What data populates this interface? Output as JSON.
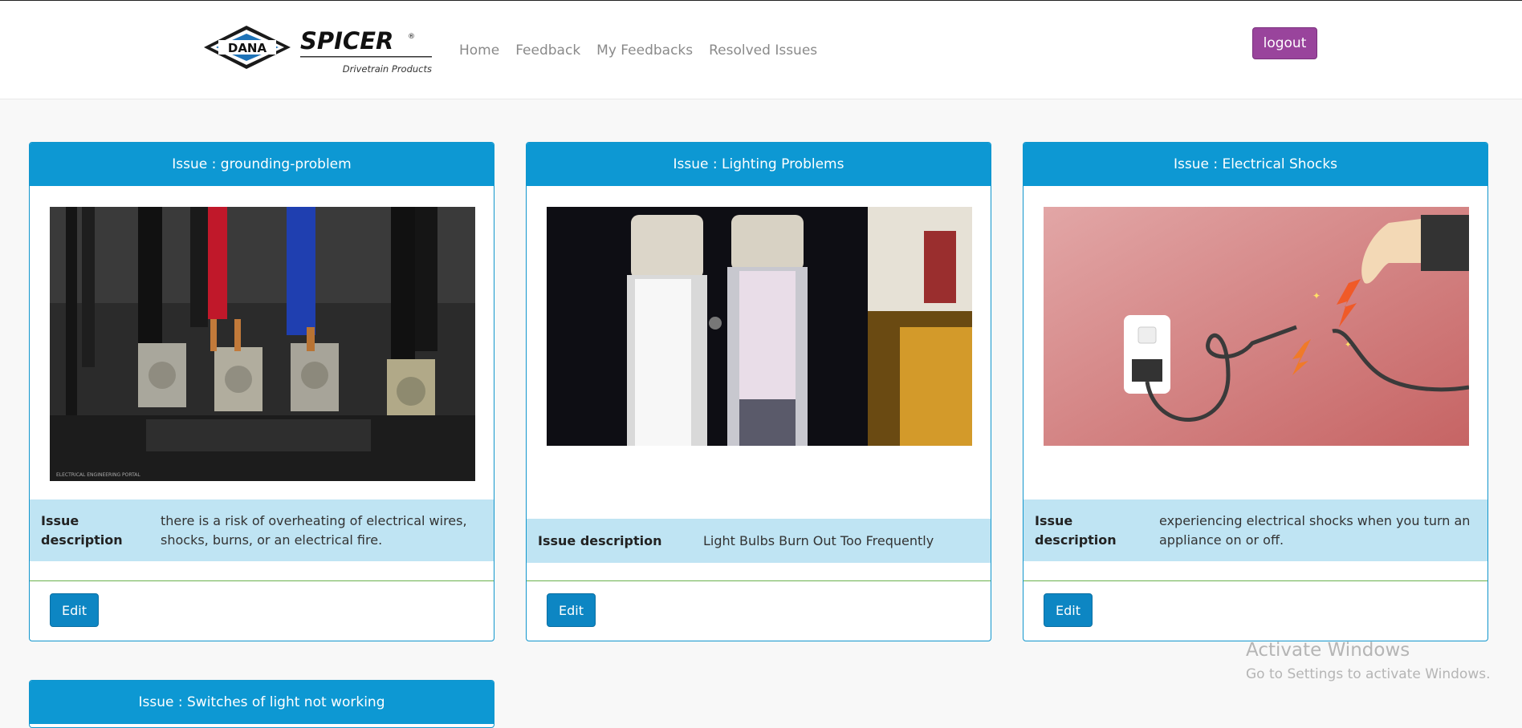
{
  "brand": {
    "dana": "DANA",
    "spicer": "SPICER",
    "registered": "®",
    "tagline": "Drivetrain Products"
  },
  "nav": {
    "links": [
      "Home",
      "Feedback",
      "My Feedbacks",
      "Resolved Issues"
    ],
    "logout_label": "logout"
  },
  "cards": [
    {
      "title": "Issue : grounding-problem",
      "description_label": "Issue description",
      "description_label_line1": "Issue",
      "description_label_line2": "description",
      "description_line1": "there is a risk of overheating of electrical wires,",
      "description_line2": "shocks, burns, or an electrical fire.",
      "edit_label": "Edit",
      "image_caption": "ELECTRICAL ENGINEERING PORTAL"
    },
    {
      "title": "Issue : Lighting Problems",
      "description_label": "Issue description",
      "description": "Light Bulbs Burn Out Too Frequently",
      "edit_label": "Edit"
    },
    {
      "title": "Issue : Electrical Shocks",
      "description_label_line1": "Issue",
      "description_label_line2": "description",
      "description_line1": "experiencing electrical shocks when you turn an",
      "description_line2": "appliance on or off.",
      "edit_label": "Edit"
    },
    {
      "title": "Issue : Switches of light not working"
    }
  ],
  "watermark": {
    "title": "Activate Windows",
    "subtitle": "Go to Settings to activate Windows."
  },
  "colors": {
    "card_header": "#0d98d3",
    "desc_row": "#bfe4f3",
    "logout": "#99449c",
    "edit": "#0d86c3"
  }
}
